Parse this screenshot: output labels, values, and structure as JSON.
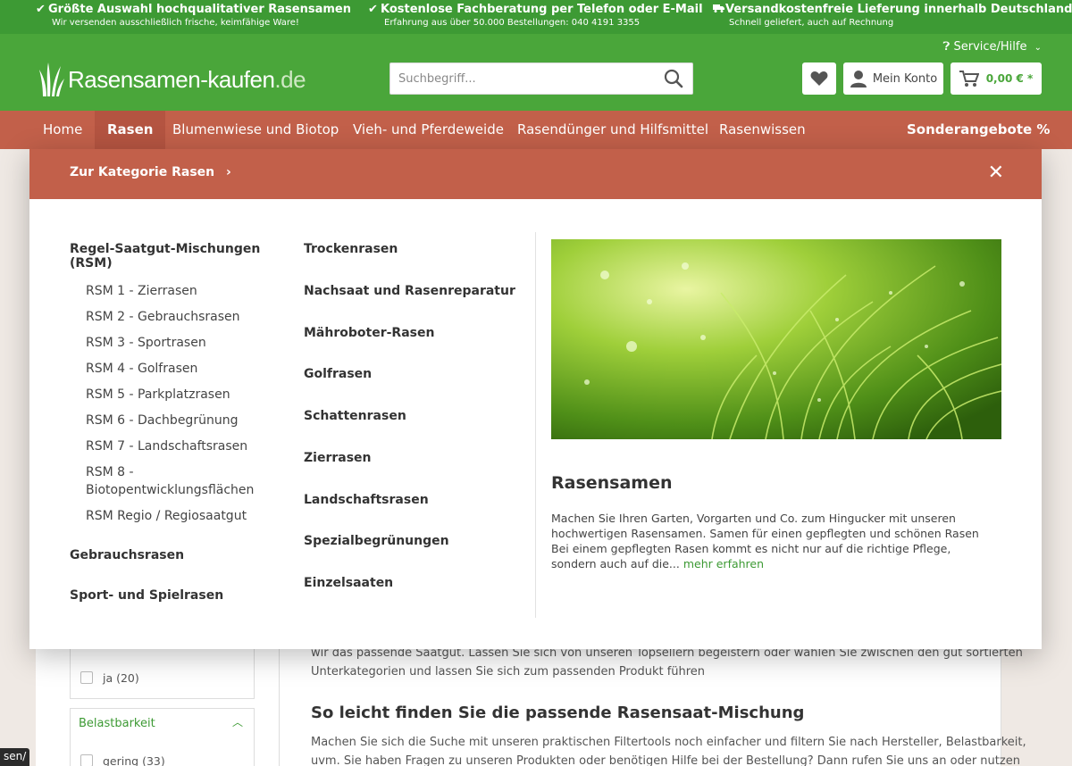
{
  "usp": [
    {
      "title": "Größte Auswahl hochqualitativer Rasensamen",
      "sub": "Wir versenden ausschließlich frische, keimfähige Ware!",
      "icon": "check-icon"
    },
    {
      "title": "Kostenlose Fachberatung per Telefon oder E-Mail",
      "sub": "Erfahrung aus über 50.000 Bestellungen: 040 4191 3355",
      "icon": "check-icon"
    },
    {
      "title": "Versandkostenfreie Lieferung innerhalb Deutschlands",
      "sub": "Schnell geliefert, auch auf Rechnung",
      "icon": "truck-icon"
    }
  ],
  "header": {
    "service_label": "Service/Hilfe",
    "logo_main": "Rasensamen-kaufen",
    "logo_tld": ".de",
    "search_placeholder": "Suchbegriff...",
    "account_label": "Mein Konto",
    "cart_total": "0,00 € *"
  },
  "nav": {
    "items": [
      "Home",
      "Rasen",
      "Blumenwiese und Biotop",
      "Vieh- und Pferdeweide",
      "Rasendünger und Hilfsmittel",
      "Rasenwissen"
    ],
    "special": "Sonderangebote %"
  },
  "flyout": {
    "category_link": "Zur Kategorie Rasen",
    "col_a": {
      "rsm_title": "Regel-Saatgut-Mischungen (RSM)",
      "rsm_items": [
        "RSM 1 - Zierrasen",
        "RSM 2 - Gebrauchsrasen",
        "RSM 3 - Sportrasen",
        "RSM 4 - Golfrasen",
        "RSM 5 - Parkplatzrasen",
        "RSM 6 - Dachbegrünung",
        "RSM 7 - Landschaftsrasen",
        "RSM 8 - Biotopentwicklungsflächen",
        "RSM Regio / Regiosaatgut"
      ],
      "more": [
        "Gebrauchsrasen",
        "Sport- und Spielrasen"
      ]
    },
    "col_b": [
      "Trockenrasen",
      "Nachsaat und Rasenreparatur",
      "Mähroboter-Rasen",
      "Golfrasen",
      "Schattenrasen",
      "Zierrasen",
      "Landschaftsrasen",
      "Spezialbegrünungen",
      "Einzelsaaten"
    ],
    "teaser": {
      "title": "Rasensamen",
      "text": "Machen Sie Ihren Garten, Vorgarten und Co. zum Hingucker mit unseren hochwertigen Rasensamen. Samen für einen gepflegten und schönen Rasen Bei einem gepflegten Rasen kommt es nicht nur auf die richtige Pflege, sondern auch auf die...",
      "more": "mehr erfahren"
    }
  },
  "background": {
    "filter_option_ja": "ja (20)",
    "filter_title": "Belastbarkeit",
    "filter_option_gering": "gering (33)",
    "text_line1": "wir das passende Saatgut. Lassen Sie sich von unseren Topsellern begeistern oder wählen Sie zwischen den gut sortierten",
    "text_line2": "Unterkategorien und lassen Sie sich zum passenden Produkt führen",
    "heading": "So leicht finden Sie die passende Rasensaat-Mischung",
    "text_line3": "Machen Sie sich die Suche mit unseren praktischen Filtertools noch einfacher und filtern Sie nach Hersteller, Belastbarkeit,",
    "text_line4": "uvm. Sie haben Fragen zu unseren Produkten oder benötigen Hilfe bei der Bestellung? Dann rufen Sie uns an oder nutzen"
  },
  "status_path": "sen/",
  "colors": {
    "green": "#4aa63a",
    "dark_green": "#3d9a34",
    "terracotta": "#c2604a"
  }
}
